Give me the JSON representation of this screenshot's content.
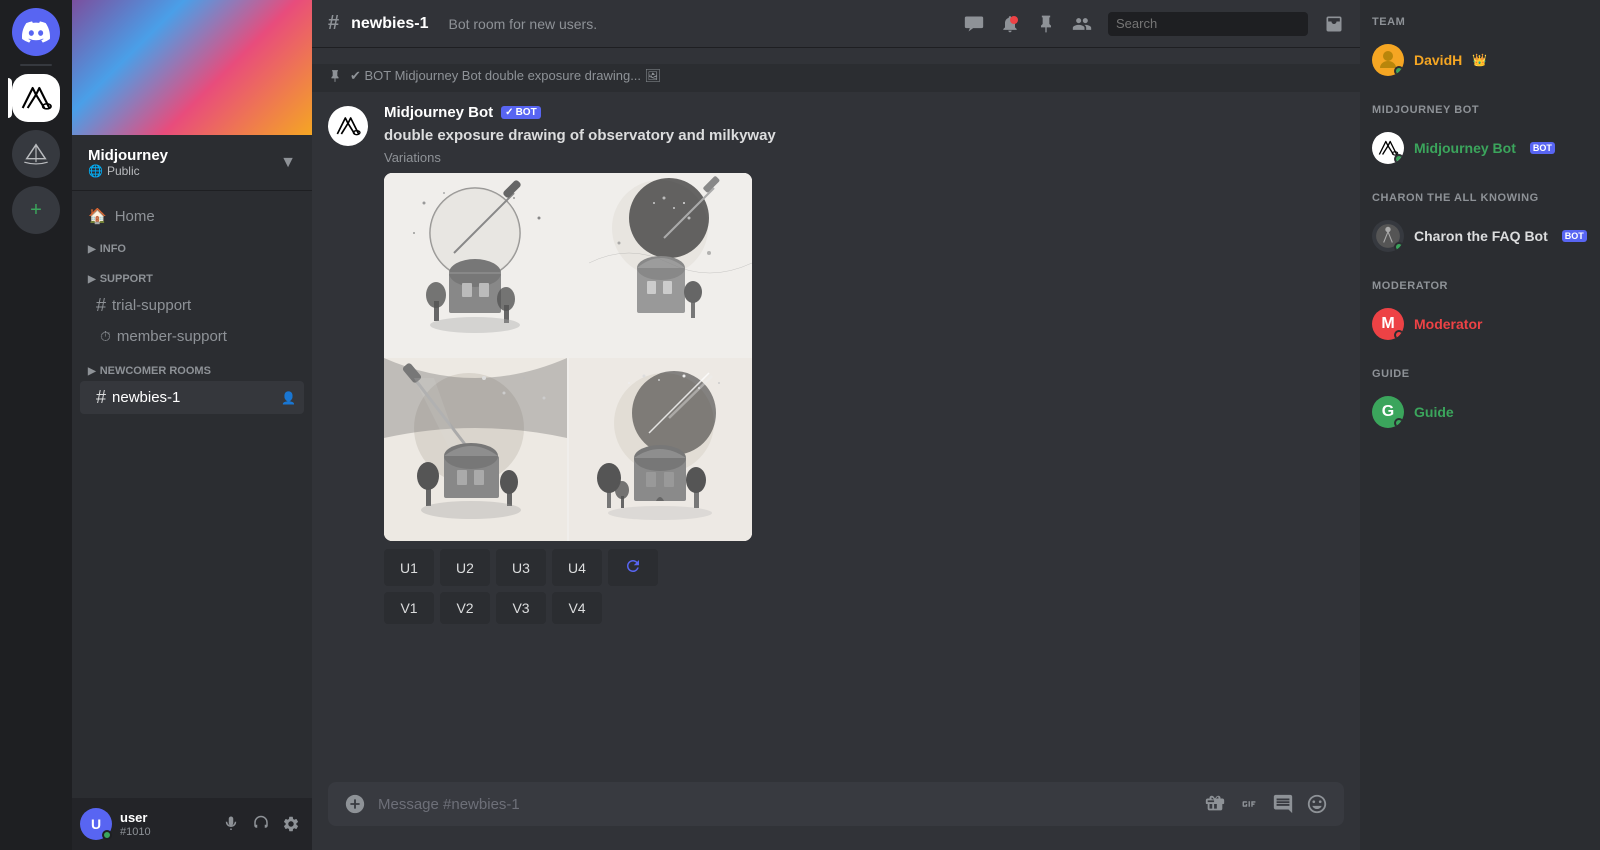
{
  "app": {
    "title": "Discord"
  },
  "icon_rail": {
    "servers": [
      {
        "id": "discord",
        "label": "Discord Home",
        "type": "discord"
      },
      {
        "id": "midjourney",
        "label": "Midjourney",
        "type": "midjourney",
        "active": true
      },
      {
        "id": "boat",
        "label": "Boat Server",
        "type": "boat"
      }
    ],
    "add_label": "Add a Server"
  },
  "sidebar": {
    "server_name": "Midjourney",
    "server_public": "Public",
    "banner_gradient": true,
    "home_label": "Home",
    "sections": [
      {
        "id": "info",
        "label": "INFO",
        "collapsed": true,
        "channels": []
      },
      {
        "id": "support",
        "label": "SUPPORT",
        "collapsed": true,
        "channels": [
          {
            "id": "trial-support",
            "name": "trial-support",
            "type": "text",
            "active": false
          },
          {
            "id": "member-support",
            "name": "member-support",
            "type": "slow",
            "active": false
          }
        ]
      },
      {
        "id": "newcomer-rooms",
        "label": "NEWCOMER ROOMS",
        "collapsed": false,
        "channels": [
          {
            "id": "newbies-1",
            "name": "newbies-1",
            "type": "text",
            "active": true
          }
        ]
      }
    ]
  },
  "chat_header": {
    "channel_name": "newbies-1",
    "description": "Bot room for new users.",
    "icons": [
      "thread",
      "notification",
      "pin",
      "member",
      "search",
      "inbox"
    ]
  },
  "search": {
    "placeholder": "Search"
  },
  "messages": [
    {
      "id": "msg1",
      "author": "Midjourney Bot",
      "is_bot": true,
      "bot_badge": "BOT",
      "verify_icon": "✓",
      "avatar_type": "boat",
      "timestamp": "",
      "text": "double exposure drawing of observatory and milkyway",
      "subtext": "Variations",
      "has_image_grid": true,
      "action_buttons": [
        "U1",
        "U2",
        "U3",
        "U4",
        "refresh",
        "V1",
        "V2",
        "V3",
        "V4"
      ]
    }
  ],
  "action_buttons": {
    "u1": "U1",
    "u2": "U2",
    "u3": "U3",
    "u4": "U4",
    "v1": "V1",
    "v2": "V2",
    "v3": "V3",
    "v4": "V4"
  },
  "message_input": {
    "placeholder": "Message #newbies-1"
  },
  "right_panel": {
    "team_section_title": "TEAM",
    "team_member": {
      "name": "DavidH",
      "avatar_color": "#5865f2"
    },
    "sections": [
      {
        "id": "midjourney-bot",
        "title": "MIDJOURNEY BOT",
        "members": [
          {
            "name": "Midjourney Bot",
            "is_bot": true,
            "bot_badge": "BOT",
            "status": "green",
            "color": "#3ba55c",
            "avatar_type": "boat"
          }
        ]
      },
      {
        "id": "charon",
        "title": "CHARON THE ALL KNOWING",
        "members": [
          {
            "name": "Charon the FAQ Bot",
            "is_bot": true,
            "bot_badge": "BOT",
            "status": "green",
            "color": "#dcddde",
            "avatar_type": "warrior"
          }
        ]
      },
      {
        "id": "moderator",
        "title": "MODERATOR",
        "members": [
          {
            "name": "Moderator",
            "is_bot": false,
            "status": "red",
            "color": "#ed4245",
            "avatar_color": "#ed4245"
          }
        ]
      },
      {
        "id": "guide",
        "title": "GUIDE",
        "members": [
          {
            "name": "Guide",
            "is_bot": false,
            "status": "green",
            "color": "#3ba55c",
            "avatar_color": "#3ba55c"
          }
        ]
      }
    ]
  },
  "user": {
    "name": "user",
    "tag": "#1010",
    "avatar_bg": "#5865f2"
  },
  "colors": {
    "accent": "#5865f2",
    "online": "#3ba55c",
    "danger": "#ed4245",
    "bot_badge": "#5865f2"
  }
}
